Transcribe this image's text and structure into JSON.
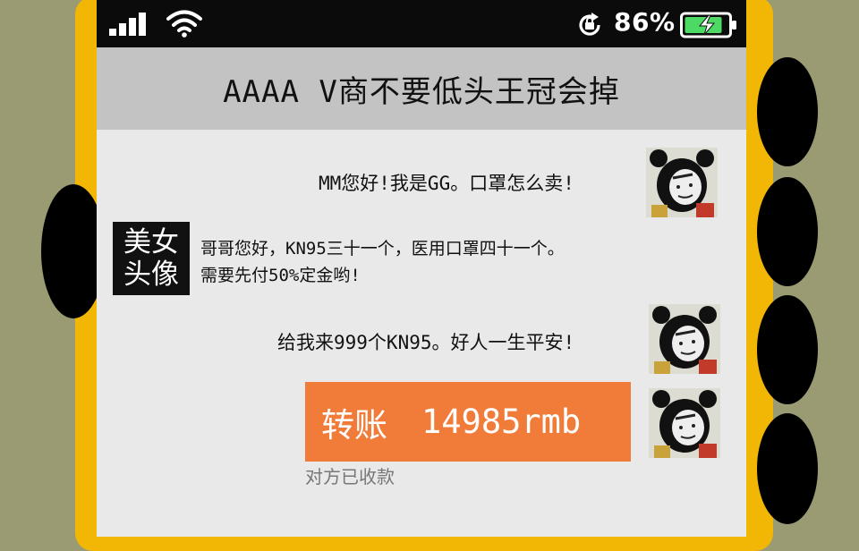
{
  "status_bar": {
    "battery_percent": "86%",
    "signal_bars": 4,
    "battery_charging": true,
    "icons": [
      "signal-icon",
      "wifi-icon",
      "rotation-lock-icon",
      "battery-charging-icon"
    ]
  },
  "chat": {
    "title": "AAAA V商不要低头王冠会掉",
    "messages": [
      {
        "sender": "self",
        "text": "MM您好!我是GG。口罩怎么卖!"
      },
      {
        "sender": "other",
        "avatar_label_line1": "美女",
        "avatar_label_line2": "头像",
        "text_line1": "哥哥您好，KN95三十一个，医用口罩四十一个。",
        "text_line2": "需要先付50%定金哟!"
      },
      {
        "sender": "self",
        "text": "给我来999个KN95。好人一生平安!"
      }
    ],
    "transfer": {
      "label": "转账",
      "amount": "14985rmb",
      "status": "对方已收款"
    }
  },
  "colors": {
    "frame": "#f2b705",
    "background": "#9a9b72",
    "title_bar": "#c3c3c3",
    "chat_bg": "#e9e9e9",
    "transfer_card": "#f17c3a"
  }
}
